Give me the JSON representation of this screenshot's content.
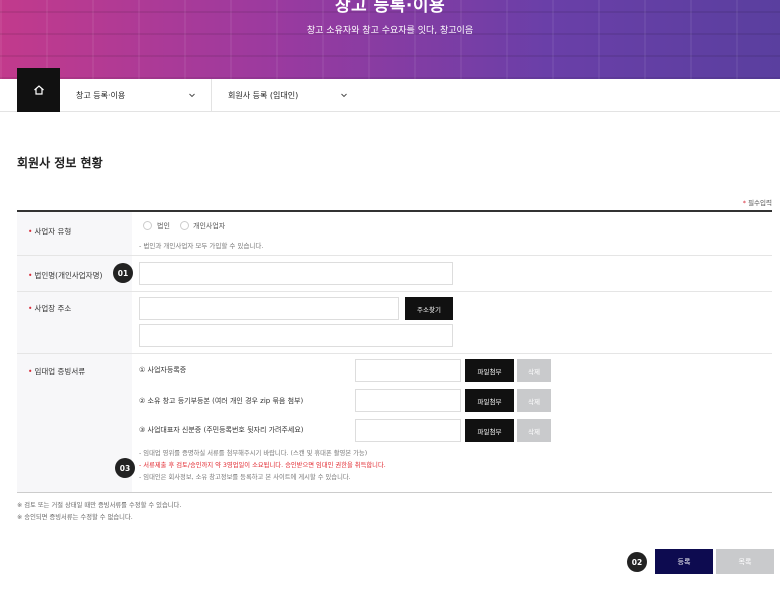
{
  "hero": {
    "title": "창고 등록·이용",
    "subtitle": "창고 소유자와 창고 수요자를 잇다, 창고이음"
  },
  "breadcrumb": {
    "items": [
      {
        "label": "창고 등록·이용"
      },
      {
        "label": "회원사 등록 (임대인)"
      }
    ]
  },
  "section": {
    "title": "회원사 정보 현황",
    "required_note": "필수입력",
    "required_star": "*"
  },
  "form": {
    "business_type": {
      "label": "사업자 유형",
      "options": [
        "법인",
        "개인사업자"
      ],
      "hint": "- 법인과 개인사업자 모두 가입할 수 있습니다."
    },
    "company_name": {
      "label": "법인명(개인사업자명)",
      "value": ""
    },
    "address": {
      "label": "사업장 주소",
      "value": "",
      "detail_value": "",
      "search_button": "주소찾기"
    },
    "documents": {
      "label": "임대업 증빙서류",
      "items": [
        {
          "label": "① 사업자등록증",
          "value": ""
        },
        {
          "label": "② 소유 창고 등기부등본 (여러 개인 경우 zip 묶음 첨부)",
          "value": ""
        },
        {
          "label": "③ 사업대표자 신분증 (주민등록번호 뒷자리 가려주세요)",
          "value": ""
        }
      ],
      "attach_label": "파일첨부",
      "delete_label": "삭제",
      "notes": [
        "- 임대업 영위를 증명하실 서류를 첨부해주시기 바랍니다. (스캔 및 휴대폰 촬영본 가능)",
        "- 서류제출 후 검토/승인까지 약 3영업일이 소요됩니다. 승인받으면 임대인 권한을 취득합니다.",
        "- 임대인은 회사정보, 소유 창고정보를 등록하고 본 사이트에 게시할 수 있습니다."
      ]
    }
  },
  "footnotes": [
    "※ 검토 또는 거절 상태일 때만 증빙서류를 수정할 수 있습니다.",
    "※ 승인되면 증빙서류는 수정할 수 없습니다."
  ],
  "steps": {
    "step1": "01",
    "step2": "02",
    "step3": "03"
  },
  "actions": {
    "submit": "등록",
    "list": "목록"
  },
  "colors": {
    "accent_navy": "#0d0b50",
    "required_red": "#d72c3a",
    "notice_red": "#e1262d",
    "disabled_gray": "#c9cacc"
  }
}
